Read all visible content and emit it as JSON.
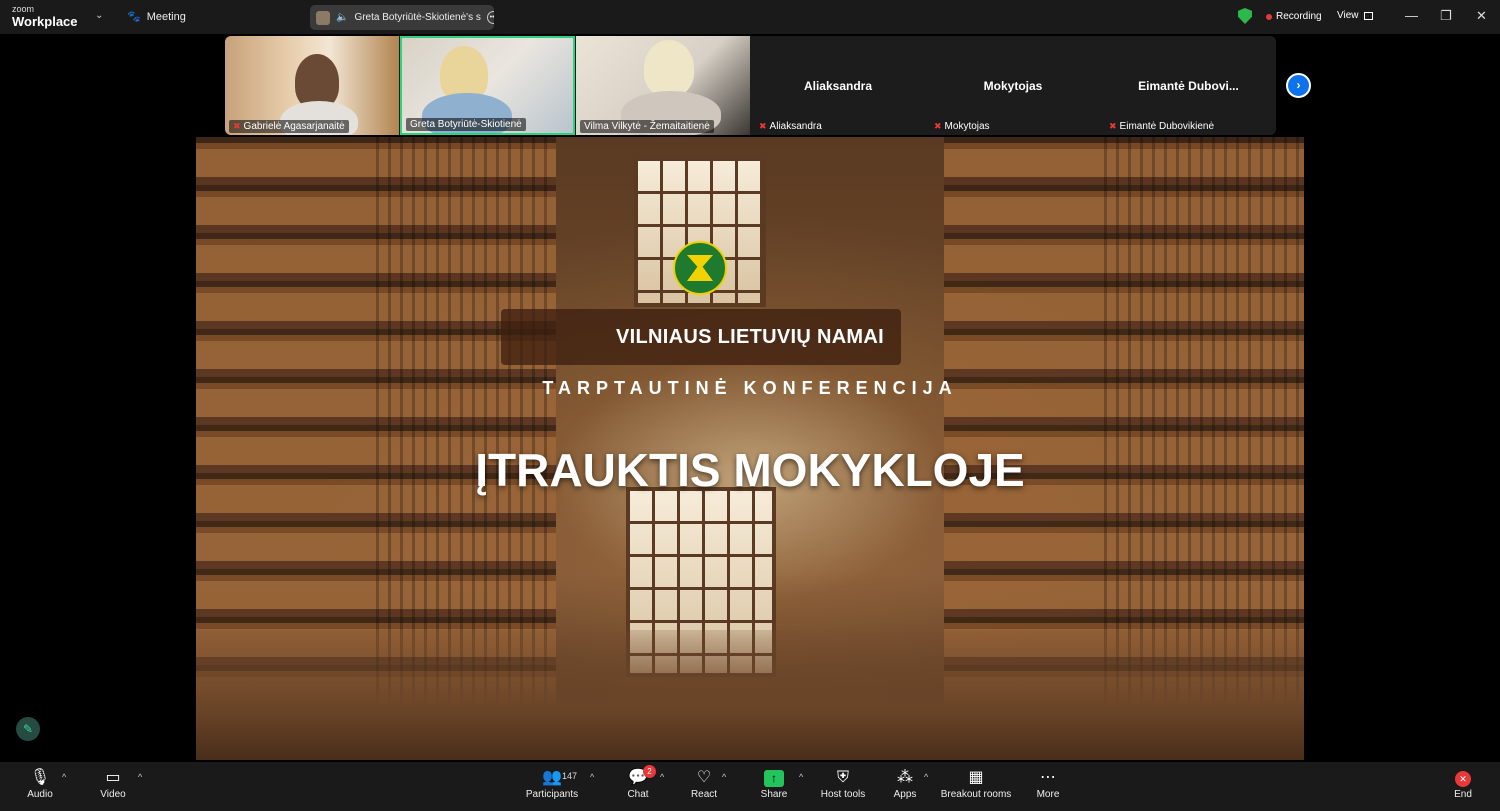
{
  "app": {
    "brand_small": "zoom",
    "brand_big": "Workplace",
    "meeting_label": "Meeting"
  },
  "share_pill": {
    "label": "Greta Botyriūtė-Skiotienė's s"
  },
  "status": {
    "recording": "Recording",
    "view": "View"
  },
  "window_controls": {
    "minimize": "—",
    "restore": "❐",
    "close": "✕"
  },
  "participants_strip": [
    {
      "name": "Gabrielė Agasarjanaitė",
      "muted": true,
      "video": true
    },
    {
      "name": "Greta Botyriūtė-Skiotienė",
      "muted": false,
      "video": true,
      "speaking": true
    },
    {
      "name": "Vilma Vilkytė - Žemaitaitienė",
      "muted": false,
      "video": true
    },
    {
      "name": "Aliaksandra",
      "center_name": "Aliaksandra",
      "muted": true,
      "video": false
    },
    {
      "name": "Mokytojas",
      "center_name": "Mokytojas",
      "muted": true,
      "video": false
    },
    {
      "name": "Eimantė Dubovikienė",
      "center_name": "Eimantė  Dubovi...",
      "muted": true,
      "video": false
    }
  ],
  "slide": {
    "line1": "VILNIAUS LIETUVIŲ NAMAI",
    "line2": "TARPTAUTINĖ  KONFERENCIJA",
    "line3": "ĮTRAUKTIS MOKYKLOJE"
  },
  "toolbar": {
    "audio": "Audio",
    "video": "Video",
    "participants": "Participants",
    "participants_count": "147",
    "chat": "Chat",
    "chat_badge": "2",
    "react": "React",
    "share": "Share",
    "host_tools": "Host tools",
    "apps": "Apps",
    "breakout_rooms": "Breakout rooms",
    "more": "More",
    "end": "End"
  },
  "colors": {
    "accent_green": "#23c45e",
    "speaking_border": "#2bd37f",
    "end_red": "#e8393a",
    "next_blue": "#0e72ed"
  }
}
